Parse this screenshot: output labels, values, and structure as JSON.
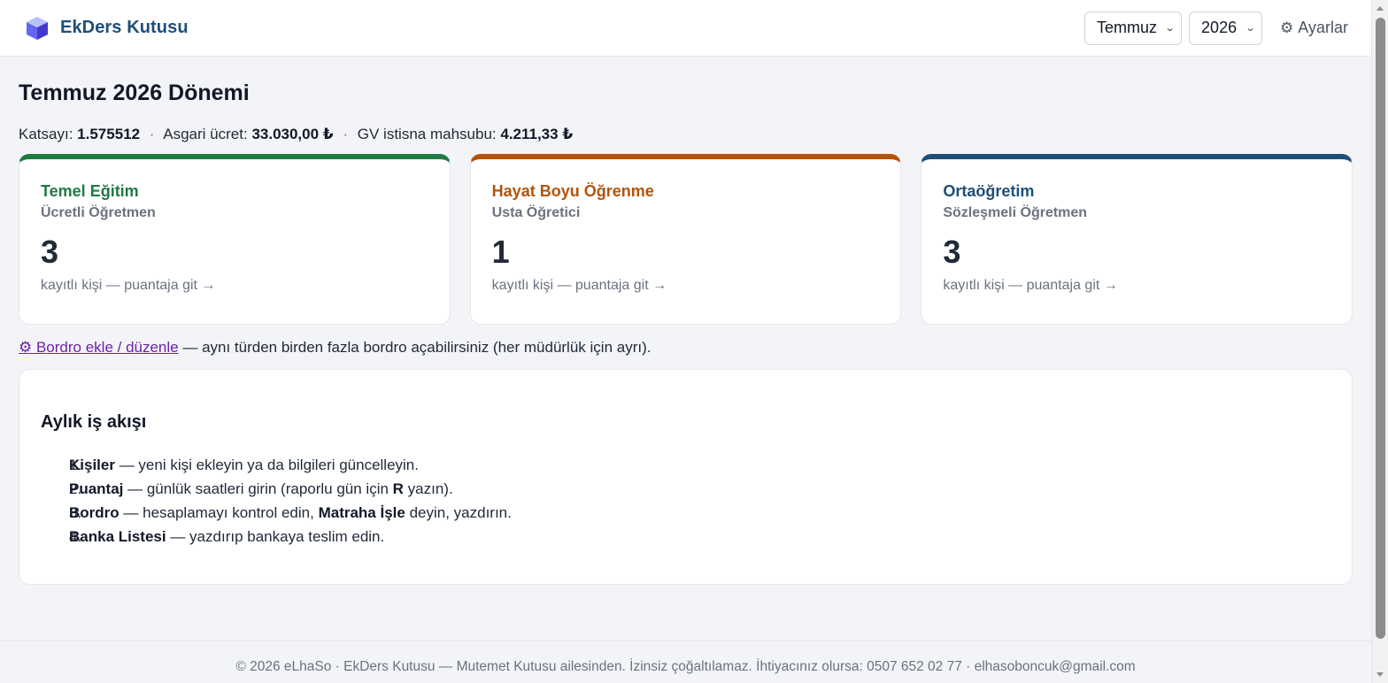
{
  "header": {
    "brand": "EkDers Kutusu",
    "month": "Temmuz",
    "year": "2026",
    "settings_label": "Ayarlar",
    "settings_icon": "gear-icon"
  },
  "page": {
    "title": "Temmuz 2026 Dönemi",
    "katsayi_label": "Katsayı:",
    "katsayi_value": "1.575512",
    "asgari_label": "Asgari ücret:",
    "asgari_value": "33.030,00 ₺",
    "gv_label": "GV istisna mahsubu:",
    "gv_value": "4.211,33 ₺",
    "separator": "·"
  },
  "cards": [
    {
      "title": "Temel Eğitim",
      "subtitle": "Ücretli Öğretmen",
      "count": "3",
      "link": "kayıtlı kişi — puantaja git →",
      "color": "#1f7a44"
    },
    {
      "title": "Hayat Boyu Öğrenme",
      "subtitle": "Usta Öğretici",
      "count": "1",
      "link": "kayıtlı kişi — puantaja git →",
      "color": "#b45309"
    },
    {
      "title": "Ortaöğretim",
      "subtitle": "Sözleşmeli Öğretmen",
      "count": "3",
      "link": "kayıtlı kişi — puantaja git →",
      "color": "#1f4e79"
    }
  ],
  "bordro": {
    "link": "⚙ Bordro ekle / düzenle",
    "note": " — aynı türden birden fazla bordro açabilirsiniz (her müdürlük için ayrı)."
  },
  "workflow": {
    "title": "Aylık iş akışı",
    "steps": [
      {
        "num": "1.",
        "bold": "Kişiler",
        "text": " — yeni kişi ekleyin ya da bilgileri güncelleyin."
      },
      {
        "num": "2.",
        "bold": "Puantaj",
        "text_a": " — günlük saatleri girin (raporlu gün için ",
        "bold_b": "R",
        "text_b": " yazın)."
      },
      {
        "num": "3.",
        "bold": "Bordro",
        "text_a": " — hesaplamayı kontrol edin, ",
        "bold_b": "Matraha İşle",
        "text_b": " deyin, yazdırın."
      },
      {
        "num": "4.",
        "bold": "Banka Listesi",
        "text": " — yazdırıp bankaya teslim edin."
      }
    ]
  },
  "footer": {
    "text": "© 2026 eLhaSo · EkDers Kutusu — Mutemet Kutusu ailesinden. İzinsiz çoğaltılamaz. İhtiyacınız olursa: 0507 652 02 77 · elhasoboncuk@gmail.com"
  }
}
